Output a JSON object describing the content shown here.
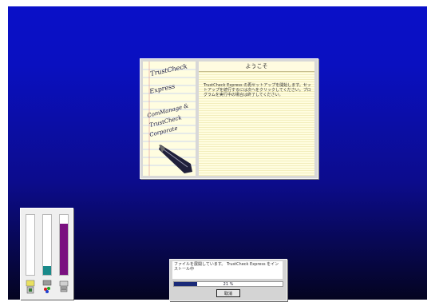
{
  "welcome": {
    "title": "ようこそ",
    "art_lines": [
      "TrustCheck",
      "Express",
      "ComManage &",
      "TrustCheck",
      "Corporate"
    ],
    "body": "TrustCheck Express の再セットアップを開始します。セットアップを続行するには次へをクリックしてください。プログラムを実行中の場合は終了してください。"
  },
  "progress": {
    "message": "ファイルを展開しています。 TrustCheck Express をインストール中",
    "percent_label": "21 %",
    "percent": 0.21,
    "cancel_label": "取消"
  },
  "meter": {
    "columns": [
      {
        "name": "system",
        "level": 0.0,
        "color": "#ffffff"
      },
      {
        "name": "user",
        "level": 0.15,
        "color": "#1a8a8a"
      },
      {
        "name": "gdi",
        "level": 0.85,
        "color": "#7a1080"
      }
    ],
    "icons": [
      "folder-icon",
      "palette-icon",
      "printer-icon"
    ]
  }
}
